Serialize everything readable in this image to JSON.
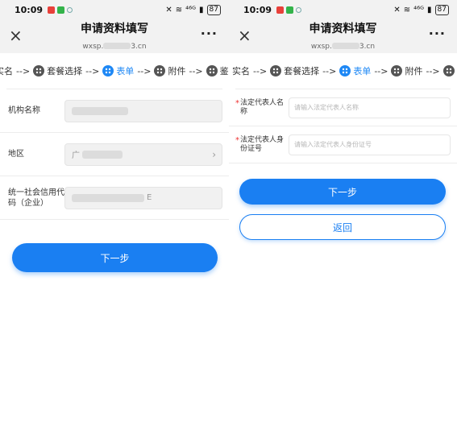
{
  "left": {
    "status": {
      "time": "10:09",
      "signal": "⁴⁶ᴳ",
      "battery": "87"
    },
    "nav": {
      "title": "申请资料填写",
      "url_prefix": "wxsp.",
      "url_suffix": "3.cn",
      "close": "×",
      "more": "···"
    },
    "steps": [
      {
        "label": "实名",
        "active": false
      },
      {
        "label": "套餐选择",
        "active": false
      },
      {
        "label": "表单",
        "active": true
      },
      {
        "label": "附件",
        "active": false
      },
      {
        "label": "鉴别",
        "active": false
      }
    ],
    "arrow": "-->",
    "fields": [
      {
        "label": "机构名称",
        "value": ""
      },
      {
        "label": "地区",
        "value": "广"
      },
      {
        "label": "统一社会信用代码（企业）",
        "value": "E"
      }
    ],
    "next_button": "下一步"
  },
  "right": {
    "status": {
      "time": "10:09",
      "signal": "⁴⁶ᴳ",
      "battery": "87"
    },
    "nav": {
      "title": "申请资料填写",
      "url_prefix": "wxsp.",
      "url_suffix": "3.cn",
      "close": "×",
      "more": "···"
    },
    "steps": [
      {
        "label": "实名",
        "active": false
      },
      {
        "label": "套餐选择",
        "active": false
      },
      {
        "label": "表单",
        "active": true
      },
      {
        "label": "附件",
        "active": false
      },
      {
        "label": "鉴别",
        "active": false
      }
    ],
    "arrow": "-->",
    "fields": [
      {
        "label": "法定代表人名称",
        "placeholder": "请输入法定代表人名称",
        "required": "*"
      },
      {
        "label": "法定代表人身份证号",
        "placeholder": "请输入法定代表人身份证号",
        "required": "*"
      }
    ],
    "next_button": "下一步",
    "back_button": "返回"
  },
  "colors": {
    "primary": "#1a7ff2",
    "active_step": "#1e88f5",
    "required": "#e33333"
  }
}
